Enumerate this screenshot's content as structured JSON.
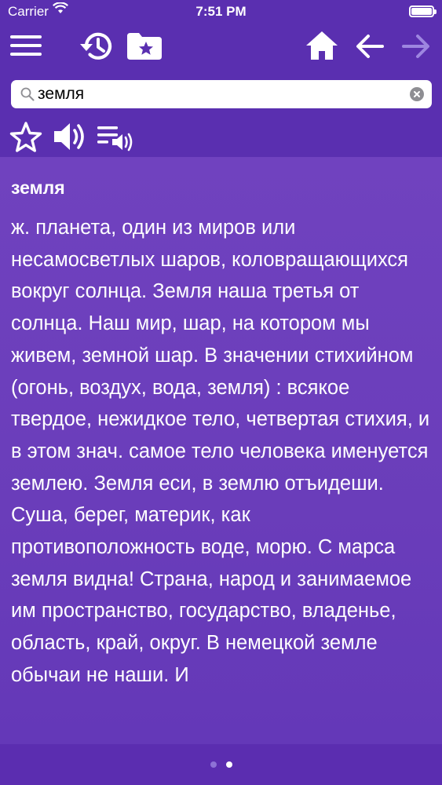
{
  "status_bar": {
    "carrier": "Carrier",
    "time": "7:51 PM"
  },
  "toolbar": {
    "icons": [
      "menu-icon",
      "history-icon",
      "bookmarks-folder-icon",
      "home-icon",
      "back-arrow-icon",
      "forward-arrow-icon"
    ]
  },
  "search": {
    "value": "земля"
  },
  "actions": {
    "icons": [
      "star-icon",
      "speaker-icon",
      "playlist-audio-icon"
    ]
  },
  "entry": {
    "headword": "земля",
    "definition": "ж. планета, один из миров или несамосветлых шаров, коловращающихся вокруг солнца. Земля наша третья от солнца. Наш мир, шар, на котором мы живем, земной шар. В значении стихийном (огонь, воздух, вода, земля) : всякое твердое, нежидкое тело, четвертая стихия, и в этом знач. самое тело человека именуется землею. Земля еси, в землю отъидеши. Суша, берег, материк, как противоположность воде, морю. С марса земля видна! Страна, народ и занимаемое им пространство, государство, владенье, область, край, округ. В немецкой земле обычаи не наши. И"
  },
  "pager": {
    "pages": 2,
    "current": 2
  },
  "colors": {
    "header_bg": "#5a2fb0",
    "content_bg": "#6a3dba",
    "text": "#ffffff",
    "inactive_icon": "#9d86e0"
  }
}
